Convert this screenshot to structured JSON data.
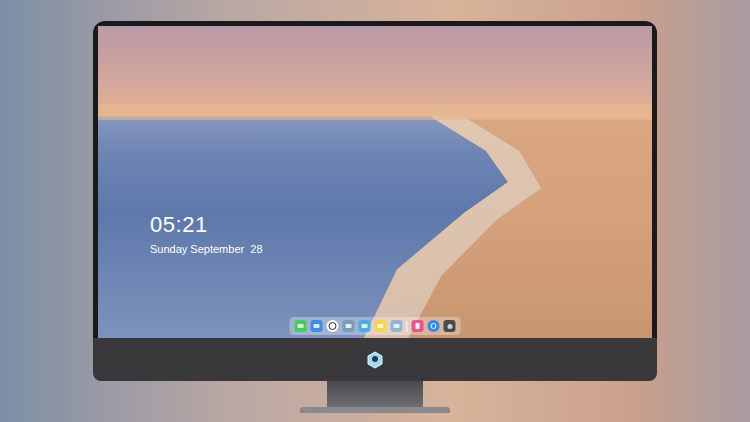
{
  "clock": {
    "time": "05:21",
    "date": "Sunday September  28"
  },
  "dock": {
    "apps": [
      {
        "kind": "messages"
      },
      {
        "kind": "finder"
      },
      {
        "kind": "clock"
      },
      {
        "kind": "preview"
      },
      {
        "kind": "video"
      },
      {
        "kind": "notes"
      },
      {
        "kind": "gallery"
      },
      {
        "kind": "separator"
      },
      {
        "kind": "music"
      },
      {
        "kind": "appstore"
      },
      {
        "kind": "camera"
      }
    ]
  }
}
